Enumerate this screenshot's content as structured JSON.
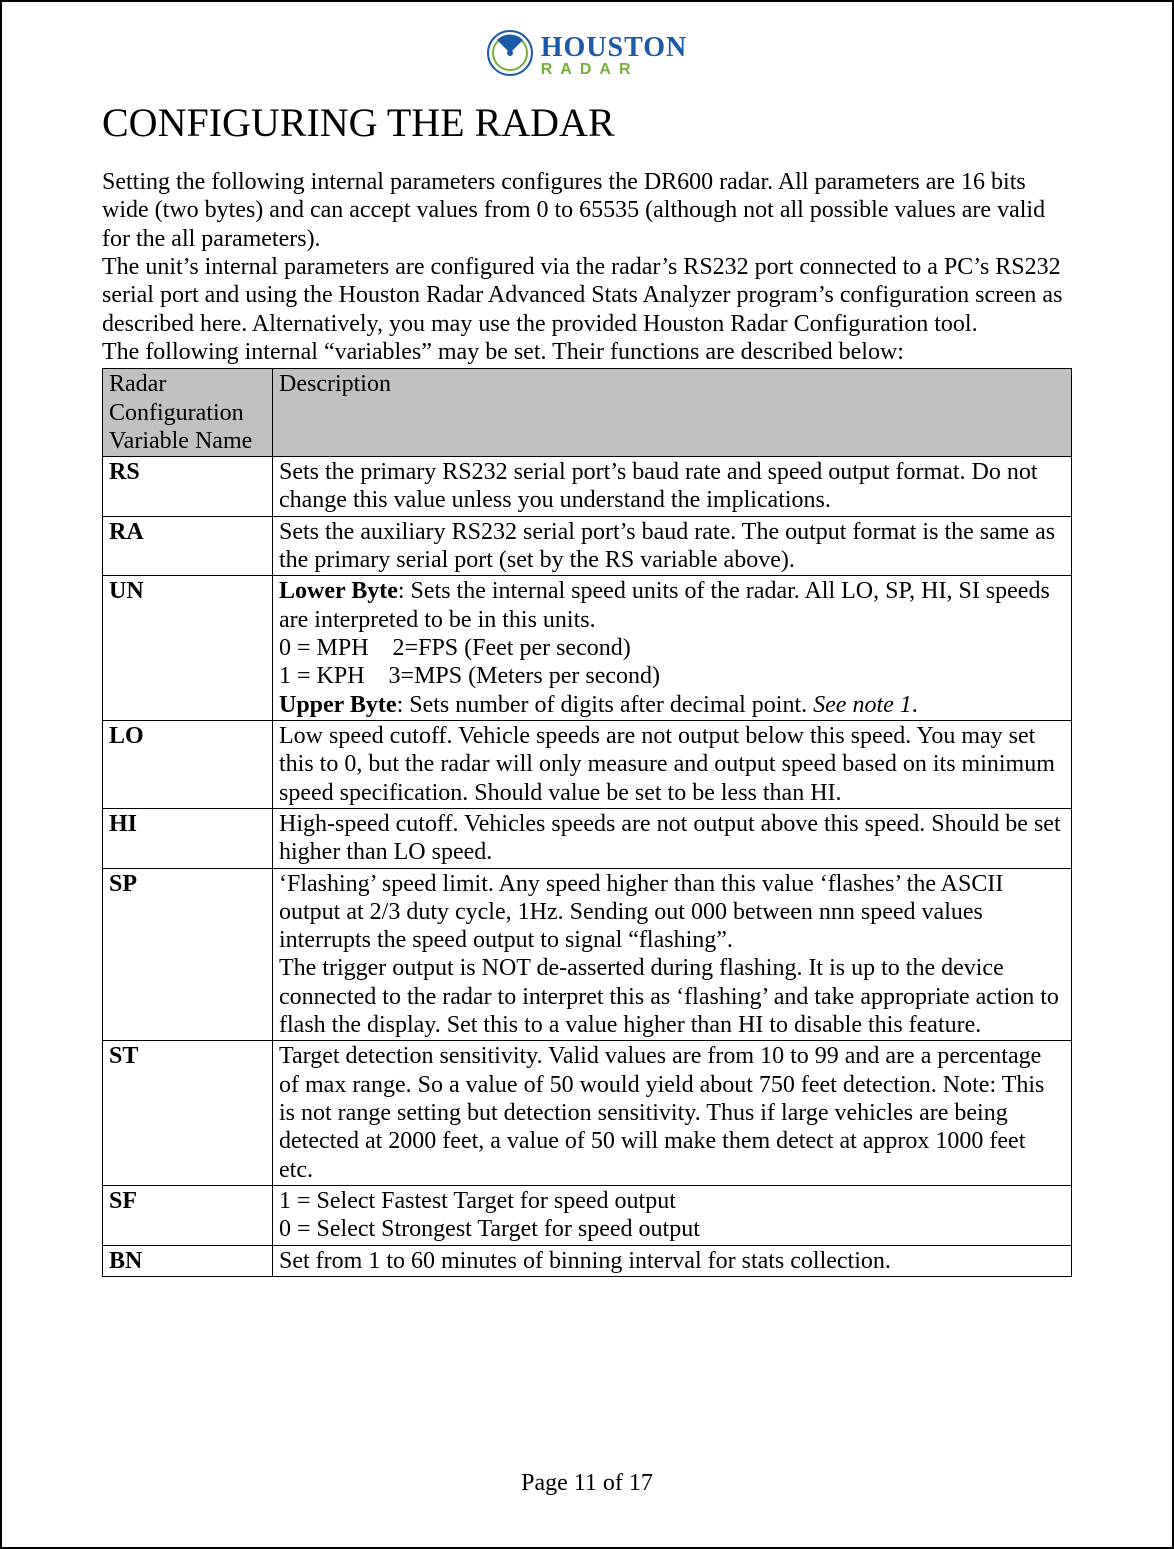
{
  "logo": {
    "line1": "HOUSTON",
    "line2": "RADAR"
  },
  "heading": "CONFIGURING THE RADAR",
  "para1": "Setting the following internal parameters configures the DR600 radar. All parameters are 16 bits wide (two bytes) and can accept values from 0 to 65535 (although not all possible values are valid for the all parameters).",
  "para2": "The unit’s internal parameters are configured via the radar’s RS232 port connected to a PC’s RS232 serial port and using the Houston Radar Advanced Stats Analyzer program’s configuration screen as described here. Alternatively, you may use the provided Houston Radar Configuration tool.",
  "para3": "The following internal “variables” may be set. Their functions are described below:",
  "table": {
    "header": {
      "col1": "Radar Configuration Variable Name",
      "col2": "Description"
    },
    "rows": {
      "rs": {
        "name": "RS",
        "desc": "Sets the primary RS232 serial port’s baud rate and speed output format. Do not change this value unless you understand the implications."
      },
      "ra": {
        "name": "RA",
        "desc": "Sets the auxiliary RS232 serial port’s baud rate. The output format is the same as the primary serial port (set by the RS variable above)."
      },
      "un": {
        "name": "UN",
        "l1a": "Lower Byte",
        "l1b": ": Sets the internal speed units of the radar. All LO, SP, HI, SI speeds are interpreted to be in this units.",
        "l2": "0 = MPH    2=FPS (Feet per second)",
        "l3": "1 = KPH    3=MPS (Meters per second)",
        "l4a": "Upper Byte",
        "l4b": ": Sets number of digits after decimal point. ",
        "l4c": "See note 1"
      },
      "lo": {
        "name": "LO",
        "desc": "Low speed cutoff. Vehicle speeds are not output below this speed. You may set this to 0, but the radar will only measure and output speed based on its minimum speed specification. Should value be set to be less than HI."
      },
      "hi": {
        "name": "HI",
        "desc": "High-speed cutoff. Vehicles speeds are not output above this speed. Should be set higher than LO speed."
      },
      "sp": {
        "name": "SP",
        "p1": "‘Flashing’ speed limit. Any speed higher than this value ‘flashes’ the ASCII output at 2/3 duty cycle, 1Hz. Sending out 000 between nnn speed values interrupts the speed output to signal “flashing”.",
        "p2": "The trigger output is NOT de-asserted during flashing. It is up to the device connected to the radar to interpret this as ‘flashing’ and take appropriate action to flash the display. Set this to a value higher than HI to disable this feature."
      },
      "st": {
        "name": "ST",
        "desc": "Target detection sensitivity. Valid values are from 10 to 99 and are a percentage of max range. So a value of 50 would yield about 750 feet detection. Note: This is not range setting but detection sensitivity. Thus if large vehicles are being detected at 2000 feet, a value of 50 will make them detect at approx 1000 feet etc."
      },
      "sf": {
        "name": "SF",
        "l1": "1 = Select Fastest Target for speed output",
        "l2": "0 = Select Strongest Target for speed output"
      },
      "bn": {
        "name": "BN",
        "desc": "Set from 1 to 60 minutes of binning interval for stats collection."
      }
    }
  },
  "footer": "Page 11 of 17"
}
